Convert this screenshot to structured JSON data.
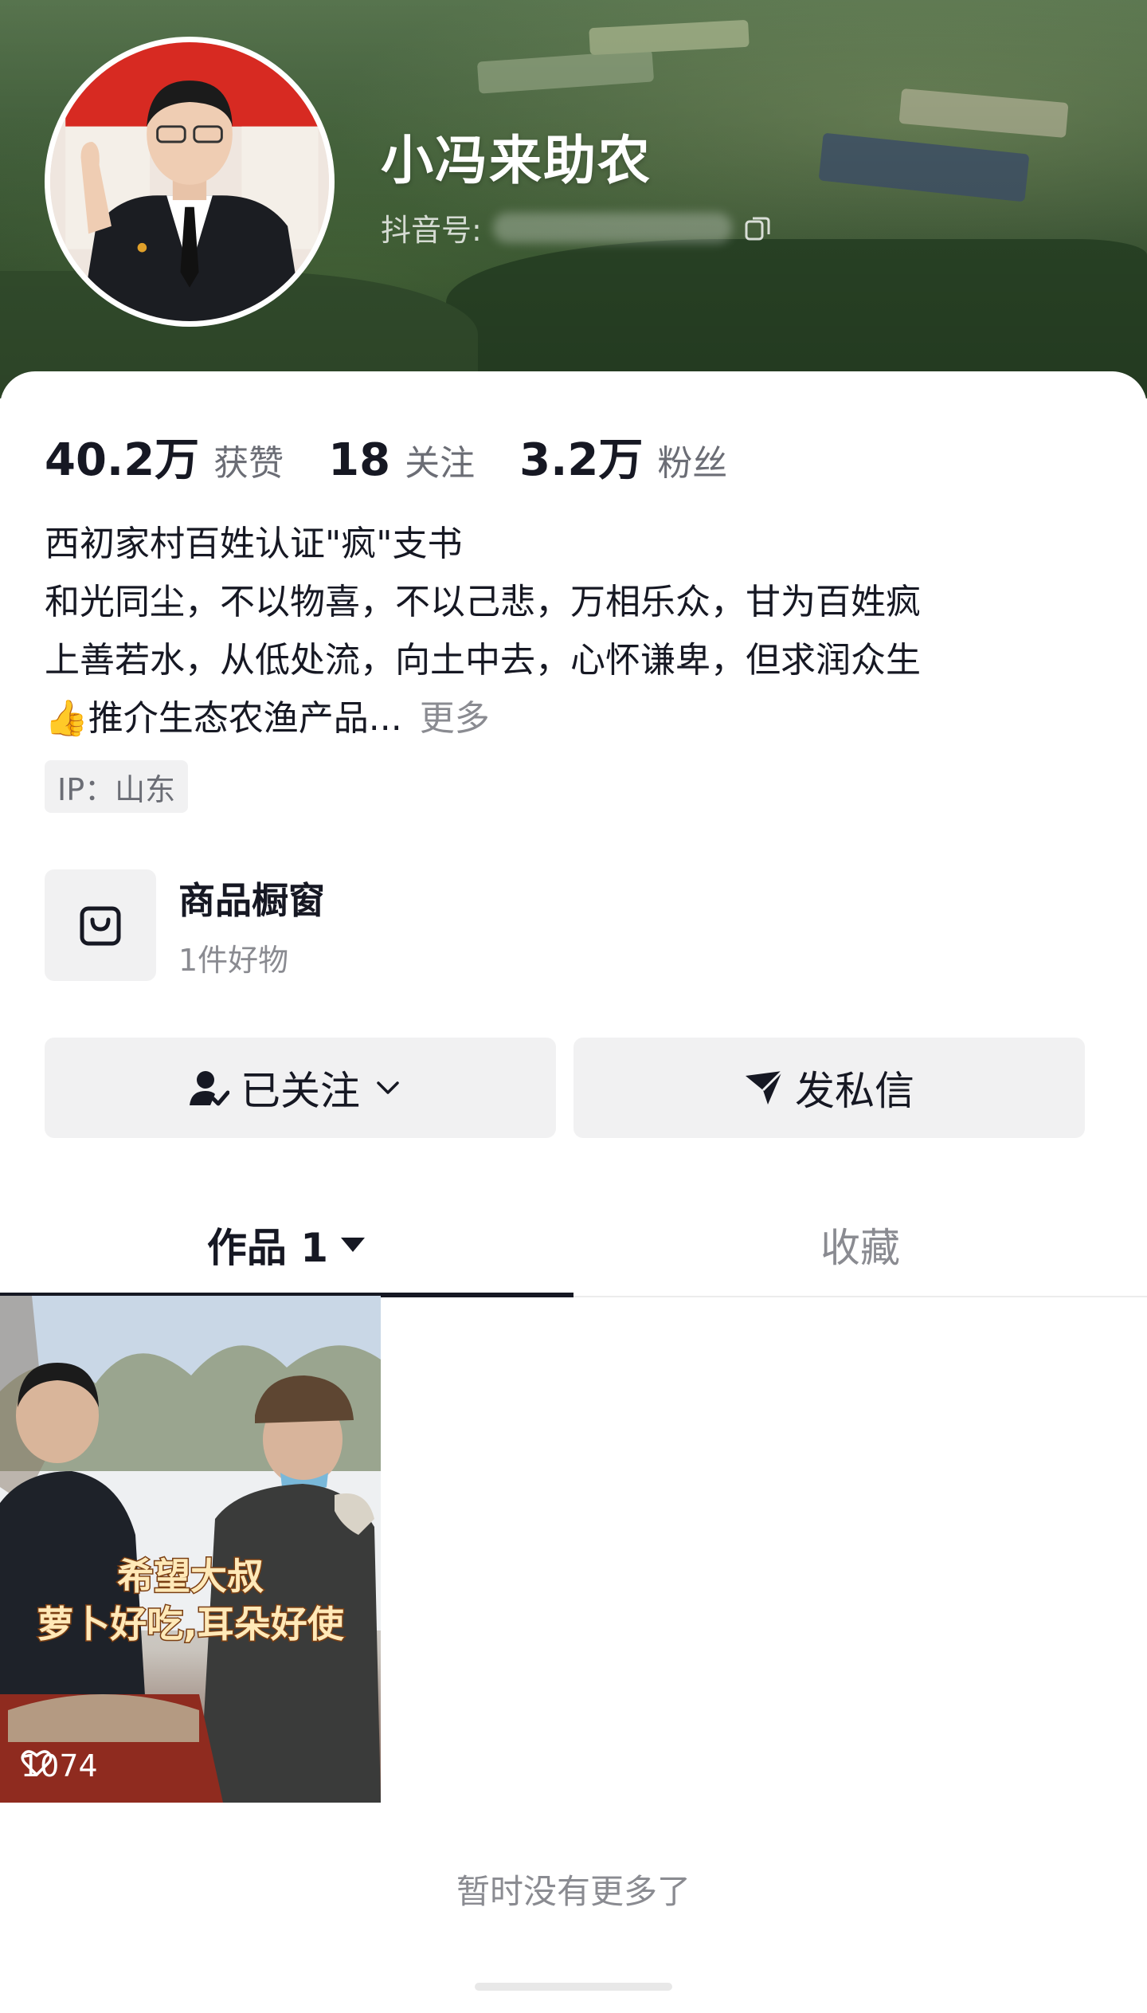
{
  "profile": {
    "nickname": "小冯来助农",
    "douyin_id_label": "抖音号: ",
    "avatar_name": "avatar-photo"
  },
  "stats": [
    {
      "value": "40.2万",
      "label": "获赞"
    },
    {
      "value": "18",
      "label": "关注"
    },
    {
      "value": "3.2万",
      "label": "粉丝"
    }
  ],
  "bio": {
    "lines": [
      "西初家村百姓认证\"疯\"支书",
      "和光同尘，不以物喜，不以己悲，万相乐众，甘为百姓疯",
      "上善若水，从低处流，向土中去，心怀谦卑，但求润众生",
      "推介生态农渔产品..."
    ],
    "emoji": "👍",
    "more_label": "更多"
  },
  "ip_tag": "IP：山东",
  "shop": {
    "title": "商品橱窗",
    "subtitle": "1件好物",
    "icon": "shopping-bag-icon"
  },
  "buttons": {
    "follow_label": "已关注",
    "message_label": "发私信"
  },
  "tabs": {
    "works_label": "作品 1",
    "favorites_label": "收藏"
  },
  "videos": [
    {
      "caption_line1": "希望大叔",
      "caption_line2": "萝卜好吃,耳朵好使",
      "likes": "1074"
    }
  ],
  "footer": {
    "no_more": "暂时没有更多了"
  },
  "colors": {
    "text_primary": "#161823",
    "text_secondary": "#8a8b91",
    "button_bg": "#f1f1f2"
  }
}
